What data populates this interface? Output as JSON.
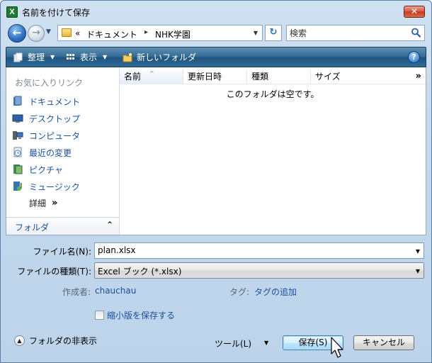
{
  "window": {
    "title": "名前を付けて保存",
    "app_icon_letter": "X",
    "close_glyph": "✕"
  },
  "address_bar": {
    "overflow": "«",
    "crumbs": [
      "ドキュメント",
      "NHK学園"
    ],
    "separator": "▸"
  },
  "search": {
    "placeholder": "検索"
  },
  "toolbar": {
    "organize_label": "整理",
    "views_label": "表示",
    "new_folder_label": "新しいフォルダ",
    "help_glyph": "?"
  },
  "nav_pane": {
    "heading": "お気に入りリンク",
    "items": [
      {
        "label": "ドキュメント",
        "icon": "documents-icon"
      },
      {
        "label": "デスクトップ",
        "icon": "desktop-icon"
      },
      {
        "label": "コンピュータ",
        "icon": "computer-icon"
      },
      {
        "label": "最近の変更",
        "icon": "recent-changes-icon"
      },
      {
        "label": "ピクチャ",
        "icon": "pictures-icon"
      },
      {
        "label": "ミュージック",
        "icon": "music-icon"
      }
    ],
    "more_label": "詳細",
    "more_glyph": "»",
    "folders_label": "フォルダ",
    "folders_glyph": "⌃"
  },
  "file_list": {
    "columns": [
      "名前",
      "更新日時",
      "種類",
      "サイズ"
    ],
    "more_glyph": "»",
    "empty_message": "このフォルダは空です。"
  },
  "form": {
    "filename_label": "ファイル名(N):",
    "filename_value": "plan.xlsx",
    "filetype_label": "ファイルの種類(T):",
    "filetype_value": "Excel ブック (*.xlsx)",
    "author_label": "作成者:",
    "author_value": "chauchau",
    "tags_label": "タグ:",
    "tags_value": "タグの追加",
    "thumbnail_label": "縮小版を保存する",
    "thumbnail_checked": false
  },
  "footer": {
    "hide_folders_label": "フォルダの非表示",
    "tools_label": "ツール(L)",
    "save_label": "保存(S)",
    "cancel_label": "キャンセル"
  },
  "colors": {
    "link_blue": "#1a4f9a",
    "toolbar_dark": "#1e557f",
    "close_red": "#c23621"
  }
}
